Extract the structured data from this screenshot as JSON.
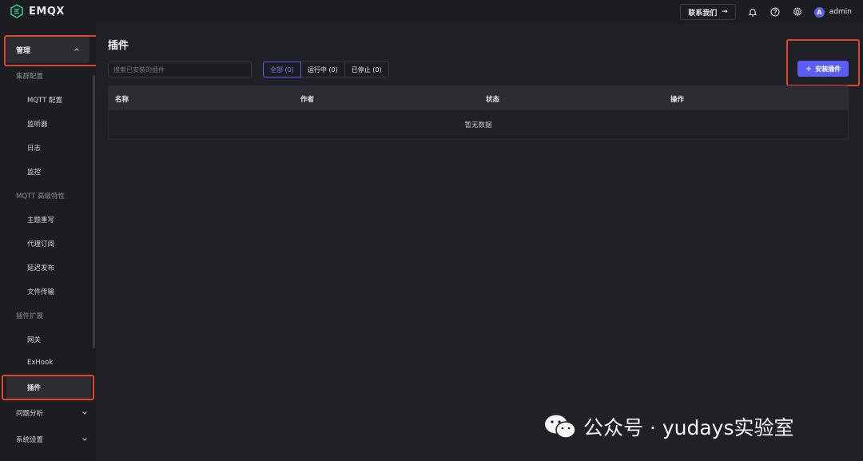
{
  "header": {
    "app_name": "EMQX",
    "contact_label": "联系我们",
    "contact_arrow": "→",
    "user_initial": "A",
    "user_name": "admin",
    "icons": [
      "bell-icon",
      "help-icon",
      "gear-icon"
    ]
  },
  "sidebar": {
    "group_manage": "管理",
    "section_cluster": "集群配置",
    "cluster_items": [
      "MQTT 配置",
      "监听器",
      "日志",
      "监控"
    ],
    "section_mqtt": "MQTT 高级特性",
    "mqtt_items": [
      "主题重写",
      "代理订阅",
      "延迟发布",
      "文件传输"
    ],
    "section_ext": "插件扩展",
    "ext_items": [
      "网关",
      "ExHook",
      "插件"
    ],
    "group_problem": "问题分析",
    "group_settings": "系统设置"
  },
  "main": {
    "title": "插件",
    "search_placeholder": "搜索已安装的插件",
    "filters": [
      "全部 (0)",
      "运行中 (0)",
      "已停止 (0)"
    ],
    "install_label": "安装插件",
    "columns": [
      "名称",
      "作者",
      "状态",
      "操作"
    ],
    "empty_text": "暂无数据"
  },
  "watermark": "公众号 · yudays实验室",
  "colors": {
    "accent": "#5b5ef1",
    "highlight": "#e0452f",
    "brand": "#3fbf8c"
  }
}
